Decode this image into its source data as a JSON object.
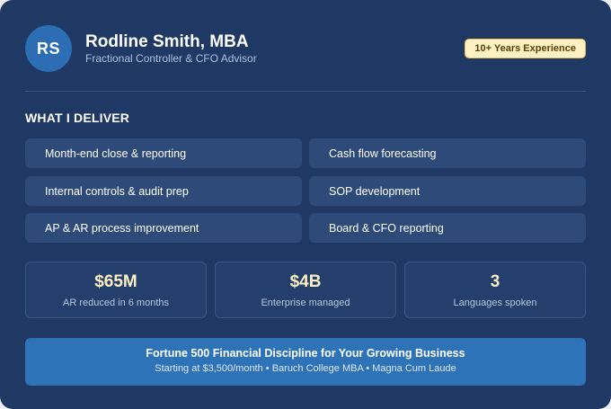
{
  "profile": {
    "initials": "RS",
    "name": "Rodline Smith, MBA",
    "title": "Fractional Controller & CFO Advisor",
    "badge": "10+ Years Experience"
  },
  "services": {
    "heading": "WHAT I DELIVER",
    "items": [
      "Month-end close & reporting",
      "Cash flow forecasting",
      "Internal controls & audit prep",
      "SOP development",
      "AP & AR process improvement",
      "Board & CFO reporting"
    ]
  },
  "stats": [
    {
      "value": "$65M",
      "label": "AR reduced in 6 months"
    },
    {
      "value": "$4B",
      "label": "Enterprise managed"
    },
    {
      "value": "3",
      "label": "Languages spoken"
    }
  ],
  "cta": {
    "title": "Fortune 500 Financial Discipline for Your Growing Business",
    "subtitle": "Starting at $3,500/month • Baruch College MBA • Magna Cum Laude"
  },
  "colors": {
    "background": "#1f3864",
    "accent": "#2e72b8",
    "highlight": "#fdf1c4"
  }
}
